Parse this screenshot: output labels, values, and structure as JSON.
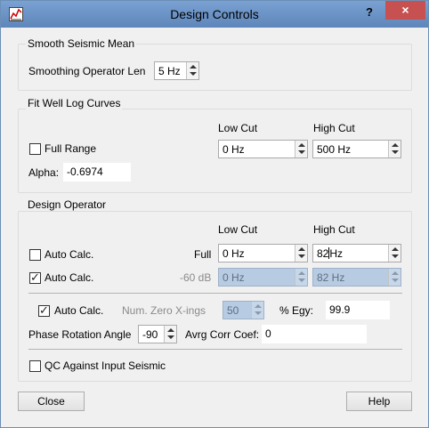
{
  "window": {
    "title": "Design Controls",
    "help_glyph": "?",
    "close_glyph": "×"
  },
  "smooth": {
    "group_title": "Smooth Seismic Mean",
    "label": "Smoothing Operator Len",
    "value": "5 Hz"
  },
  "fit": {
    "group_title": "Fit Well Log Curves",
    "low_cut_header": "Low Cut",
    "high_cut_header": "High Cut",
    "full_range_label": "Full Range",
    "full_range_checked": false,
    "low_cut_value": "0 Hz",
    "high_cut_value": "500 Hz",
    "alpha_label": "Alpha:",
    "alpha_value": "-0.6974"
  },
  "design": {
    "group_title": "Design Operator",
    "low_cut_header": "Low Cut",
    "high_cut_header": "High Cut",
    "row1": {
      "auto_label": "Auto Calc.",
      "checked": false,
      "level_label": "Full",
      "low": "0 Hz",
      "high_num": "82",
      "high_unit": "Hz"
    },
    "row2": {
      "auto_label": "Auto Calc.",
      "checked": true,
      "level_label": "-60 dB",
      "low": "0 Hz",
      "high": "82 Hz"
    },
    "zero": {
      "auto_label": "Auto Calc.",
      "checked": true,
      "label": "Num. Zero X-ings",
      "value": "50"
    },
    "egy": {
      "label": "% Egy:",
      "value": "99.9"
    },
    "phase": {
      "label": "Phase Rotation Angle",
      "value": "-90"
    },
    "corr": {
      "label": "Avrg Corr Coef:",
      "value": "0"
    },
    "qc": {
      "label": "QC Against Input Seismic",
      "checked": false
    }
  },
  "buttons": {
    "close": "Close",
    "help": "Help"
  }
}
